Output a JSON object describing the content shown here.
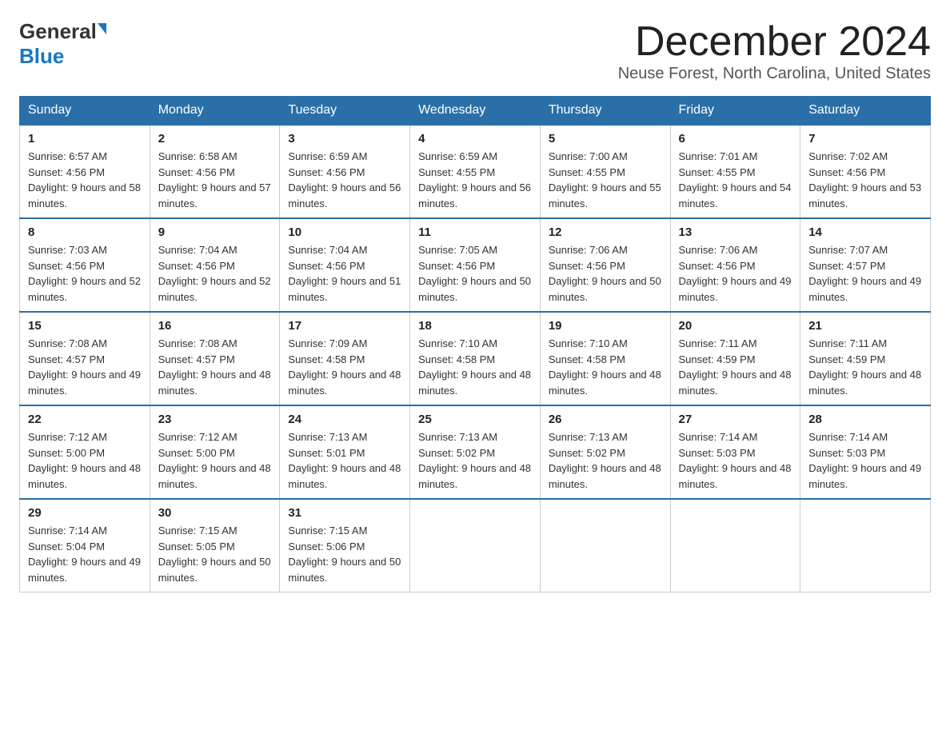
{
  "header": {
    "logo_general": "General",
    "logo_blue": "Blue",
    "month_title": "December 2024",
    "location": "Neuse Forest, North Carolina, United States"
  },
  "days_of_week": [
    "Sunday",
    "Monday",
    "Tuesday",
    "Wednesday",
    "Thursday",
    "Friday",
    "Saturday"
  ],
  "weeks": [
    [
      {
        "day": "1",
        "sunrise": "6:57 AM",
        "sunset": "4:56 PM",
        "daylight": "9 hours and 58 minutes."
      },
      {
        "day": "2",
        "sunrise": "6:58 AM",
        "sunset": "4:56 PM",
        "daylight": "9 hours and 57 minutes."
      },
      {
        "day": "3",
        "sunrise": "6:59 AM",
        "sunset": "4:56 PM",
        "daylight": "9 hours and 56 minutes."
      },
      {
        "day": "4",
        "sunrise": "6:59 AM",
        "sunset": "4:55 PM",
        "daylight": "9 hours and 56 minutes."
      },
      {
        "day": "5",
        "sunrise": "7:00 AM",
        "sunset": "4:55 PM",
        "daylight": "9 hours and 55 minutes."
      },
      {
        "day": "6",
        "sunrise": "7:01 AM",
        "sunset": "4:55 PM",
        "daylight": "9 hours and 54 minutes."
      },
      {
        "day": "7",
        "sunrise": "7:02 AM",
        "sunset": "4:56 PM",
        "daylight": "9 hours and 53 minutes."
      }
    ],
    [
      {
        "day": "8",
        "sunrise": "7:03 AM",
        "sunset": "4:56 PM",
        "daylight": "9 hours and 52 minutes."
      },
      {
        "day": "9",
        "sunrise": "7:04 AM",
        "sunset": "4:56 PM",
        "daylight": "9 hours and 52 minutes."
      },
      {
        "day": "10",
        "sunrise": "7:04 AM",
        "sunset": "4:56 PM",
        "daylight": "9 hours and 51 minutes."
      },
      {
        "day": "11",
        "sunrise": "7:05 AM",
        "sunset": "4:56 PM",
        "daylight": "9 hours and 50 minutes."
      },
      {
        "day": "12",
        "sunrise": "7:06 AM",
        "sunset": "4:56 PM",
        "daylight": "9 hours and 50 minutes."
      },
      {
        "day": "13",
        "sunrise": "7:06 AM",
        "sunset": "4:56 PM",
        "daylight": "9 hours and 49 minutes."
      },
      {
        "day": "14",
        "sunrise": "7:07 AM",
        "sunset": "4:57 PM",
        "daylight": "9 hours and 49 minutes."
      }
    ],
    [
      {
        "day": "15",
        "sunrise": "7:08 AM",
        "sunset": "4:57 PM",
        "daylight": "9 hours and 49 minutes."
      },
      {
        "day": "16",
        "sunrise": "7:08 AM",
        "sunset": "4:57 PM",
        "daylight": "9 hours and 48 minutes."
      },
      {
        "day": "17",
        "sunrise": "7:09 AM",
        "sunset": "4:58 PM",
        "daylight": "9 hours and 48 minutes."
      },
      {
        "day": "18",
        "sunrise": "7:10 AM",
        "sunset": "4:58 PM",
        "daylight": "9 hours and 48 minutes."
      },
      {
        "day": "19",
        "sunrise": "7:10 AM",
        "sunset": "4:58 PM",
        "daylight": "9 hours and 48 minutes."
      },
      {
        "day": "20",
        "sunrise": "7:11 AM",
        "sunset": "4:59 PM",
        "daylight": "9 hours and 48 minutes."
      },
      {
        "day": "21",
        "sunrise": "7:11 AM",
        "sunset": "4:59 PM",
        "daylight": "9 hours and 48 minutes."
      }
    ],
    [
      {
        "day": "22",
        "sunrise": "7:12 AM",
        "sunset": "5:00 PM",
        "daylight": "9 hours and 48 minutes."
      },
      {
        "day": "23",
        "sunrise": "7:12 AM",
        "sunset": "5:00 PM",
        "daylight": "9 hours and 48 minutes."
      },
      {
        "day": "24",
        "sunrise": "7:13 AM",
        "sunset": "5:01 PM",
        "daylight": "9 hours and 48 minutes."
      },
      {
        "day": "25",
        "sunrise": "7:13 AM",
        "sunset": "5:02 PM",
        "daylight": "9 hours and 48 minutes."
      },
      {
        "day": "26",
        "sunrise": "7:13 AM",
        "sunset": "5:02 PM",
        "daylight": "9 hours and 48 minutes."
      },
      {
        "day": "27",
        "sunrise": "7:14 AM",
        "sunset": "5:03 PM",
        "daylight": "9 hours and 48 minutes."
      },
      {
        "day": "28",
        "sunrise": "7:14 AM",
        "sunset": "5:03 PM",
        "daylight": "9 hours and 49 minutes."
      }
    ],
    [
      {
        "day": "29",
        "sunrise": "7:14 AM",
        "sunset": "5:04 PM",
        "daylight": "9 hours and 49 minutes."
      },
      {
        "day": "30",
        "sunrise": "7:15 AM",
        "sunset": "5:05 PM",
        "daylight": "9 hours and 50 minutes."
      },
      {
        "day": "31",
        "sunrise": "7:15 AM",
        "sunset": "5:06 PM",
        "daylight": "9 hours and 50 minutes."
      },
      null,
      null,
      null,
      null
    ]
  ],
  "labels": {
    "sunrise_prefix": "Sunrise: ",
    "sunset_prefix": "Sunset: ",
    "daylight_prefix": "Daylight: "
  }
}
